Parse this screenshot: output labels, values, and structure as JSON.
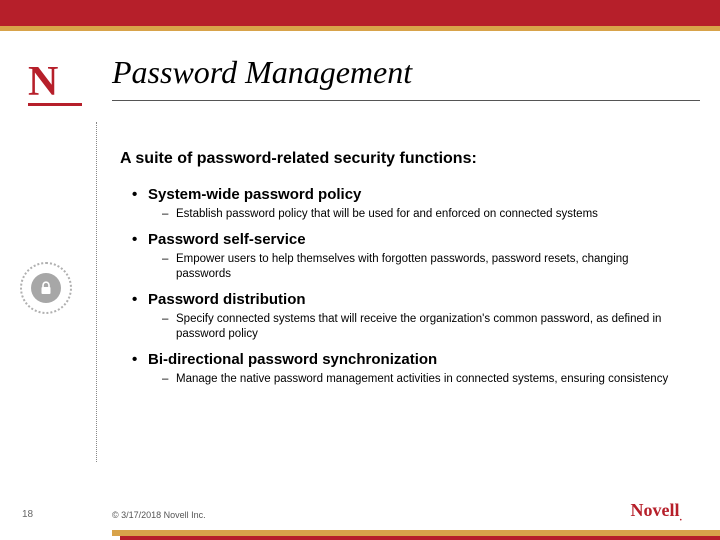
{
  "brand_letter": "N",
  "title": "Password Management",
  "intro": "A suite of password-related security functions:",
  "items": [
    {
      "label": "System-wide password policy",
      "subs": [
        "Establish password policy that will be used for and enforced on connected systems"
      ]
    },
    {
      "label": "Password self-service",
      "subs": [
        "Empower users to help themselves with forgotten passwords, password resets, changing passwords"
      ]
    },
    {
      "label": "Password distribution",
      "subs": [
        "Specify connected systems that will receive the organization's common password, as defined in password policy"
      ]
    },
    {
      "label": "Bi-directional password synchronization",
      "subs": [
        "Manage the native password management activities in connected systems, ensuring consistency"
      ]
    }
  ],
  "slide_number": "18",
  "copyright": "© 3/17/2018 Novell Inc.",
  "brand_name": "Novell",
  "icon": {
    "name": "lock-icon"
  }
}
